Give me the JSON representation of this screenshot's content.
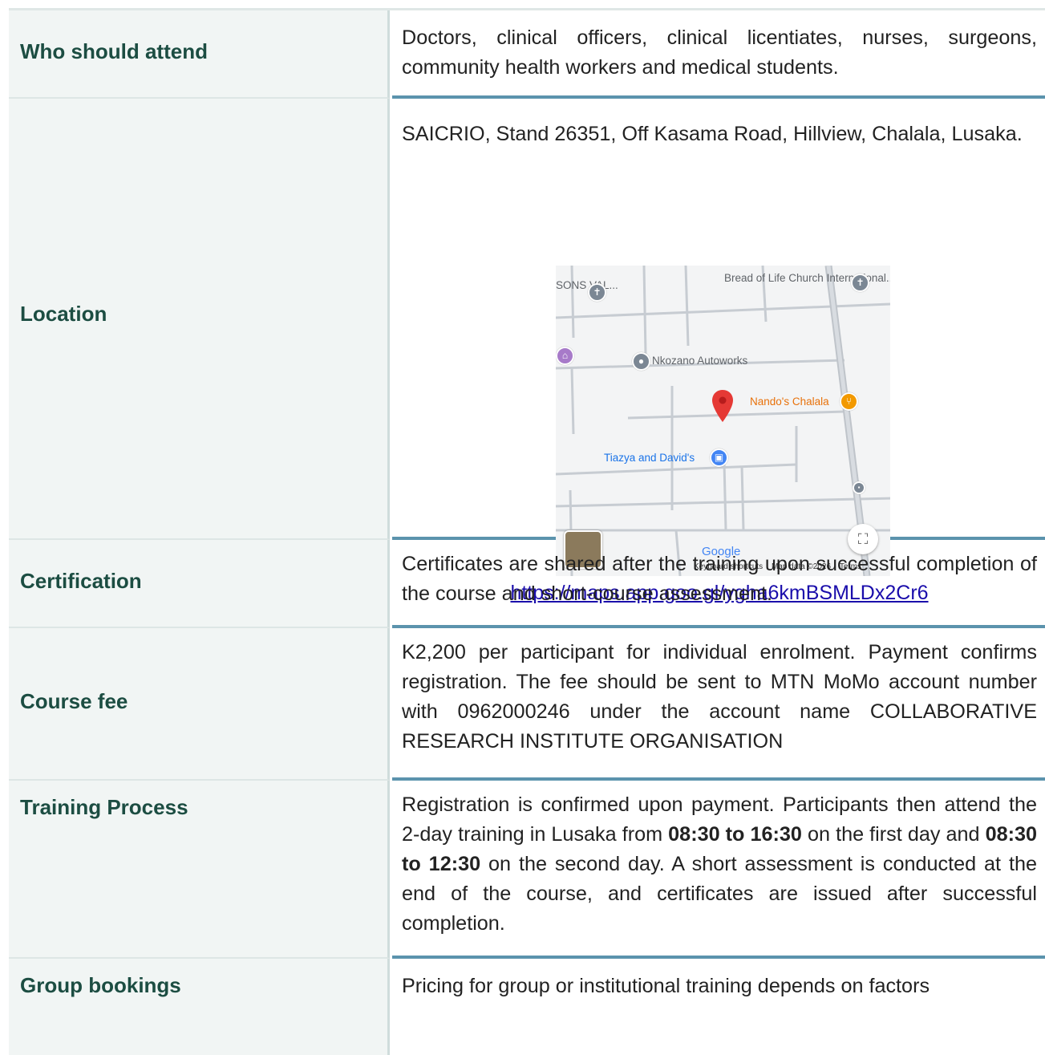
{
  "rows": [
    {
      "label": "Who should attend",
      "value": "Doctors, clinical officers, clinical licentiates, nurses, surgeons, community health workers and medical students."
    },
    {
      "label": "Location",
      "value": "SAICRIO, Stand 26351, Off Kasama Road, Hillview, Chalala, Lusaka.",
      "map": {
        "places": {
          "church": "Bread of Life Church International...",
          "sons": "SONS VAL...",
          "autoworks": "Nkozano Autoworks",
          "nandos": "Nando's Chalala",
          "tiazya": "Tiazya and David's"
        },
        "google": "Google",
        "footer": {
          "shortcuts": "Keyboard shortcuts",
          "mapdata": "Map data ©2026",
          "terms": "Terms"
        },
        "link": "https://maps.app.goo.gl/ygha6kmBSMLDx2Cr6"
      }
    },
    {
      "label": "Certification",
      "value": "Certificates are shared after the training upon successful completion of the course and short-course assessment."
    },
    {
      "label": "Course fee",
      "value": "K2,200 per participant for individual enrolment. Payment confirms registration. The fee should be sent to MTN MoMo account number with 0962000246 under the account name COLLABORATIVE RESEARCH INSTITUTE ORGANISATION"
    },
    {
      "label": "Training Process",
      "value_parts": {
        "p1": "Registration is confirmed upon payment. Participants then attend the 2-day training in Lusaka from ",
        "b1": "08:30 to 16:30",
        "p2": " on the first day and ",
        "b2": "08:30 to 12:30",
        "p3": " on the second day. A short assessment is conducted at the end of the course, and certificates are issued after successful completion."
      }
    },
    {
      "label": "Group bookings",
      "value": "Pricing for group or institutional training depends on factors"
    }
  ],
  "colors": {
    "label_text": "#1c4d42",
    "label_bg": "#f1f5f4",
    "divider": "#5b93ad",
    "link": "#1a0dab"
  }
}
